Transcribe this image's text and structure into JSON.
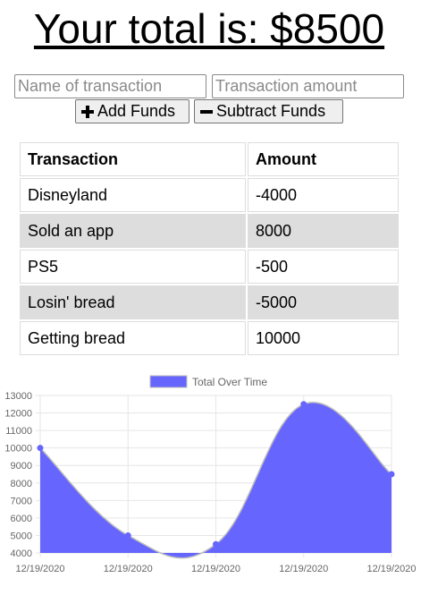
{
  "header": {
    "total_label": "Your total is: $8500"
  },
  "form": {
    "name_placeholder": "Name of transaction",
    "amount_placeholder": "Transaction amount",
    "add_label": "Add Funds",
    "subtract_label": "Subtract Funds"
  },
  "table": {
    "headers": [
      "Transaction",
      "Amount"
    ],
    "rows": [
      [
        "Disneyland",
        "-4000"
      ],
      [
        "Sold an app",
        "8000"
      ],
      [
        "PS5",
        "-500"
      ],
      [
        "Losin' bread",
        "-5000"
      ],
      [
        "Getting bread",
        "10000"
      ]
    ]
  },
  "colors": {
    "series_fill": "#6666ff",
    "row_alt": "#dddddd"
  },
  "chart_data": {
    "type": "area",
    "categories": [
      "12/19/2020",
      "12/19/2020",
      "12/19/2020",
      "12/19/2020",
      "12/19/2020"
    ],
    "series": [
      {
        "name": "Total Over Time",
        "values": [
          10000,
          5000,
          4500,
          12500,
          8500
        ]
      }
    ],
    "yticks": [
      4000,
      5000,
      6000,
      7000,
      8000,
      9000,
      10000,
      11000,
      12000,
      13000
    ],
    "ylim": [
      4000,
      13000
    ],
    "grid": true,
    "legend": "top"
  }
}
